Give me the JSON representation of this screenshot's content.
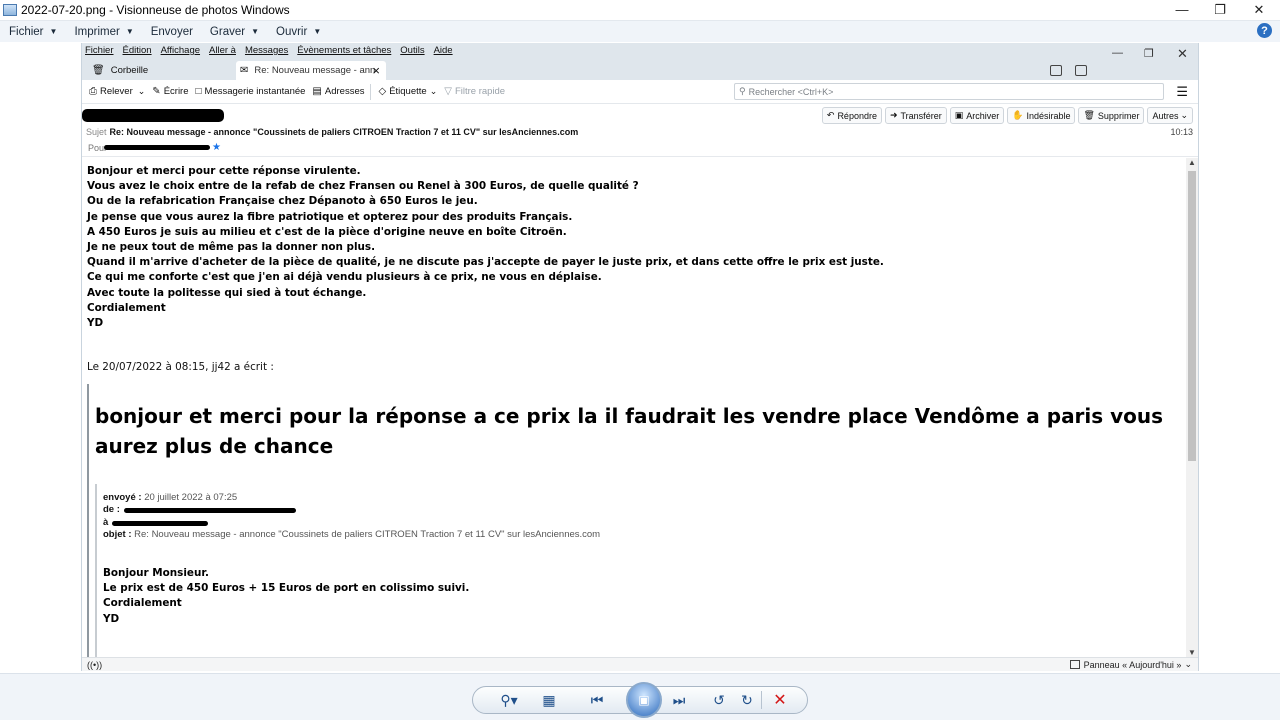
{
  "viewer": {
    "title": "2022-07-20.png - Visionneuse de photos Windows",
    "menu": [
      "Fichier",
      "Imprimer",
      "Envoyer",
      "Graver",
      "Ouvrir"
    ],
    "help": "?"
  },
  "thunderbird": {
    "menus": [
      "Fichier",
      "Édition",
      "Affichage",
      "Aller à",
      "Messages",
      "Évènements et tâches",
      "Outils",
      "Aide"
    ],
    "tabs": [
      {
        "label": "Corbeille",
        "active": false
      },
      {
        "label": "Re: Nouveau message - ann",
        "active": true
      }
    ],
    "toolbar": {
      "relever": "Relever",
      "ecrire": "Écrire",
      "messagerie": "Messagerie instantanée",
      "adresses": "Adresses",
      "etiquette": "Étiquette",
      "filtre": "Filtre rapide",
      "search_placeholder": "Rechercher <Ctrl+K>"
    },
    "header": {
      "subject_label": "Sujet",
      "subject": "Re: Nouveau message - annonce \"Coussinets de paliers CITROEN Traction 7 et 11 CV\" sur lesAnciennes.com",
      "to_label": "Pour",
      "time": "10:13",
      "buttons": {
        "repondre": "Répondre",
        "transferer": "Transférer",
        "archiver": "Archiver",
        "indesirable": "Indésirable",
        "supprimer": "Supprimer",
        "autres": "Autres"
      }
    },
    "body": {
      "lines": [
        "Bonjour et merci pour cette réponse virulente.",
        "Vous avez le choix entre de la refab de chez Fransen ou Renel à 300 Euros, de quelle qualité ?",
        "Ou de la refabrication Française chez Dépanoto à 650 Euros le jeu.",
        "Je pense que vous aurez la fibre patriotique et opterez pour des produits Français.",
        "A 450 Euros je suis au milieu et c'est de la pièce d'origine neuve en boîte Citroën.",
        "Je ne peux tout de même pas la donner non plus.",
        "Quand il m'arrive d'acheter de la pièce de qualité, je ne discute pas j'accepte de payer le juste prix, et dans cette offre le prix est juste.",
        "Ce qui me conforte c'est que j'en ai déjà vendu plusieurs à ce prix, ne vous en déplaise.",
        "Avec toute la politesse qui sied à tout échange.",
        "Cordialement",
        "YD"
      ],
      "attribution": "Le 20/07/2022 à 08:15, jj42 a écrit :",
      "quote": "bonjour et merci pour la réponse a ce prix la il faudrait les vendre place Vendôme a paris vous aurez plus de chance",
      "meta": {
        "envoye_label": "envoyé :",
        "envoye": "20 juillet 2022 à 07:25",
        "de_label": "de :",
        "a_label": "à",
        "objet_label": "objet :",
        "objet": "Re: Nouveau message - annonce \"Coussinets de paliers CITROEN Traction 7 et 11 CV\" sur lesAnciennes.com"
      },
      "inner_lines": [
        "Bonjour Monsieur.",
        "Le prix est de 450 Euros + 15 Euros de port en colissimo suivi.",
        "Cordialement",
        "YD"
      ]
    },
    "status": {
      "panel": "Panneau « Aujourd'hui »"
    }
  }
}
